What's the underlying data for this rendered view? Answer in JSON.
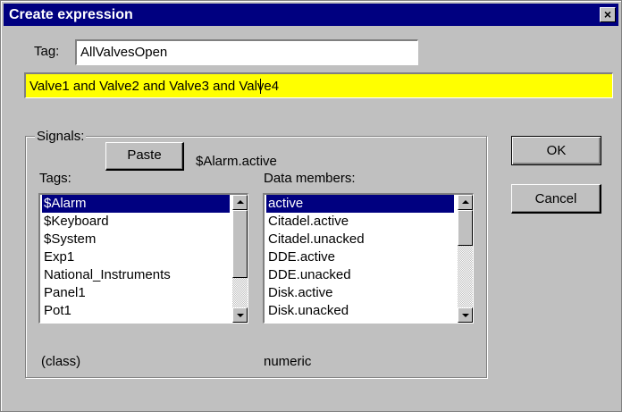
{
  "window": {
    "title": "Create expression",
    "close_symbol": "×"
  },
  "tag": {
    "label": "Tag:",
    "value": "AllValvesOpen"
  },
  "expression": {
    "value": "Valve1 and Valve2 and Valve3 and Valve4",
    "background": "#ffff00"
  },
  "signals": {
    "caption": "Signals:",
    "paste_label": "Paste",
    "selected_signal": "$Alarm.active",
    "tags_label": "Tags:",
    "tags": [
      "$Alarm",
      "$Keyboard",
      "$System",
      "Exp1",
      "National_Instruments",
      "Panel1",
      "Pot1"
    ],
    "tags_selected_index": 0,
    "members_label": "Data members:",
    "members": [
      "active",
      "Citadel.active",
      "Citadel.unacked",
      "DDE.active",
      "DDE.unacked",
      "Disk.active",
      "Disk.unacked"
    ],
    "members_selected_index": 0,
    "tag_type": "(class)",
    "member_type": "numeric"
  },
  "buttons": {
    "ok_label": "OK",
    "cancel_label": "Cancel"
  },
  "colors": {
    "title_bar": "#000080",
    "selection": "#000080",
    "face": "#c0c0c0"
  },
  "icons": {
    "close": "close-icon",
    "scroll_up": "scroll-up-arrow-icon",
    "scroll_down": "scroll-down-arrow-icon"
  }
}
